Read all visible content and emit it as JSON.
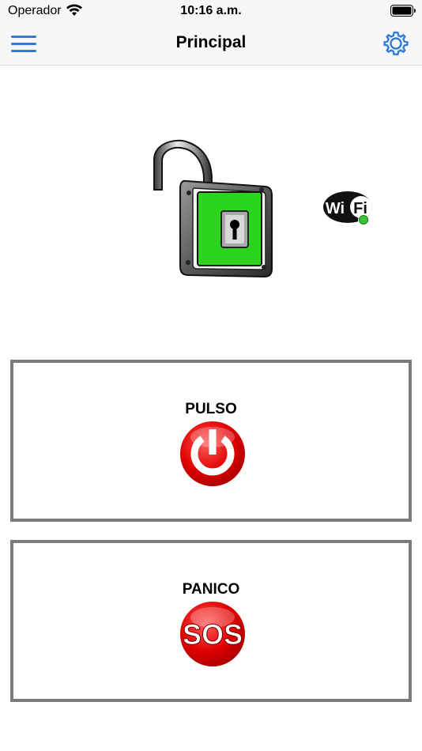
{
  "status_bar": {
    "carrier": "Operador",
    "time": "10:16 a.m.",
    "wifi_icon": "wifi-signal-icon",
    "battery_icon": "battery-icon"
  },
  "nav": {
    "title": "Principal",
    "menu_icon": "hamburger-menu-icon",
    "settings_icon": "gear-icon",
    "accent_color": "#2f7bd6"
  },
  "status": {
    "lock_icon": "unlocked-padlock-icon",
    "lock_state": "unlocked",
    "lock_color": "#2bd41d",
    "wifi_logo_text_1": "Wi",
    "wifi_logo_text_2": "Fi",
    "wifi_connected_color": "#3ac43a"
  },
  "actions": {
    "pulse": {
      "label": "PULSO",
      "icon": "power-button-icon",
      "color": "#e00000"
    },
    "panic": {
      "label": "PANICO",
      "icon": "sos-button-icon",
      "icon_text": "SOS",
      "color": "#e00000"
    }
  }
}
